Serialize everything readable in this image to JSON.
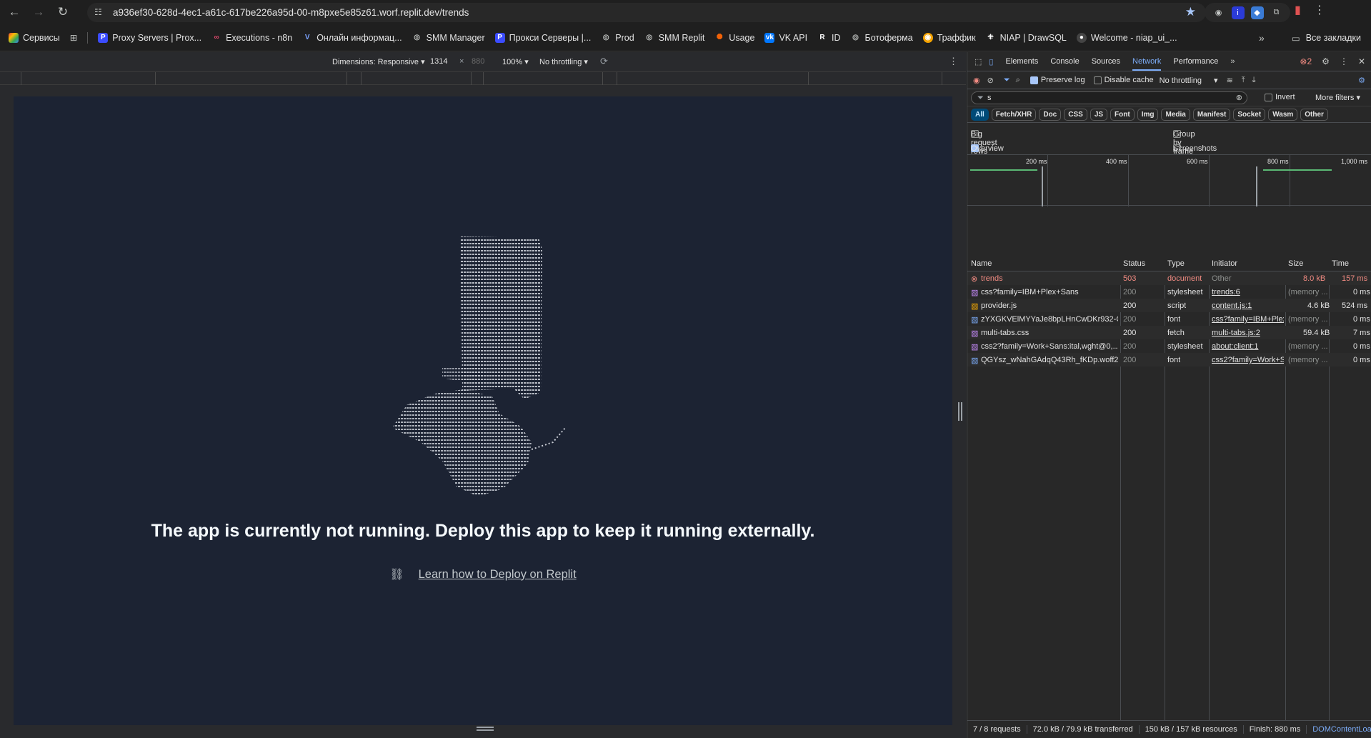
{
  "browser": {
    "url": "a936ef30-628d-4ec1-a61c-617be226a95d-00-m8pxe5e85z61.worf.replit.dev/trends",
    "bookmarks": [
      {
        "label": "Сервисы",
        "icon": "apps-grid-icon",
        "color": "#ea4335"
      },
      {
        "label": "Proxy Servers | Prox...",
        "icon": "proxy-icon",
        "color": "#3b4cff"
      },
      {
        "label": "Executions - n8n",
        "icon": "n8n-icon",
        "color": "#ea4b71"
      },
      {
        "label": "Онлайн информац...",
        "icon": "v-icon",
        "color": "#7aa2ff"
      },
      {
        "label": "SMM Manager",
        "icon": "globe-icon",
        "color": "#9aa0a6"
      },
      {
        "label": "Прокси Серверы |...",
        "icon": "proxy-icon",
        "color": "#3b4cff"
      },
      {
        "label": "Prod",
        "icon": "globe-icon",
        "color": "#9aa0a6"
      },
      {
        "label": "SMM Replit",
        "icon": "globe-icon",
        "color": "#9aa0a6"
      },
      {
        "label": "Usage",
        "icon": "replit-icon",
        "color": "#f26207"
      },
      {
        "label": "VK API",
        "icon": "vk-icon",
        "color": "#0077ff"
      },
      {
        "label": "ID",
        "icon": "r-icon",
        "color": "#ffffff"
      },
      {
        "label": "Ботоферма",
        "icon": "globe-icon",
        "color": "#9aa0a6"
      },
      {
        "label": "Траффик",
        "icon": "traffic-icon",
        "color": "#f4a300"
      },
      {
        "label": "NIAP | DrawSQL",
        "icon": "drawsql-icon",
        "color": "#ffffff"
      },
      {
        "label": "Welcome - niap_ui_...",
        "icon": "github-icon",
        "color": "#ffffff"
      }
    ],
    "all_bookmarks": "Все закладки"
  },
  "device_toolbar": {
    "dimensions": "Dimensions: Responsive",
    "width": "1314",
    "x": "×",
    "height": "880",
    "zoom": "100%",
    "throttling": "No throttling"
  },
  "page": {
    "message": "The app is currently not running. Deploy this app to keep it running externally.",
    "link": "Learn how to Deploy on Replit"
  },
  "devtools": {
    "tabs": [
      "Elements",
      "Console",
      "Sources",
      "Network",
      "Performance"
    ],
    "active_tab": "Network",
    "error_count": "2",
    "preserve_log": "Preserve log",
    "disable_cache": "Disable cache",
    "throttling": "No throttling",
    "filter_value": "s",
    "invert": "Invert",
    "more_filters": "More filters",
    "types": [
      "All",
      "Fetch/XHR",
      "Doc",
      "CSS",
      "JS",
      "Font",
      "Img",
      "Media",
      "Manifest",
      "Socket",
      "Wasm",
      "Other"
    ],
    "options": {
      "big_rows": "Big request rows",
      "group_by_frame": "Group by frame",
      "overview": "Overview",
      "screenshots": "Screenshots"
    },
    "timeline_ticks": [
      "200 ms",
      "400 ms",
      "600 ms",
      "800 ms",
      "1,000 ms"
    ],
    "columns": [
      "Name",
      "Status",
      "Type",
      "Initiator",
      "Size",
      "Time"
    ],
    "rows": [
      {
        "name": "trends",
        "status": "503",
        "type": "document",
        "initiator": "Other",
        "size": "8.0 kB",
        "time": "157 ms"
      },
      {
        "name": "css?family=IBM+Plex+Sans",
        "status": "200",
        "type": "stylesheet",
        "initiator": "trends:6",
        "size": "(memory ...",
        "time": "0 ms"
      },
      {
        "name": "provider.js",
        "status": "200",
        "type": "script",
        "initiator": "content.js:1",
        "size": "4.6 kB",
        "time": "524 ms"
      },
      {
        "name": "zYXGKVElMYYaJe8bpLHnCwDKr932-G...",
        "status": "200",
        "type": "font",
        "initiator": "css?family=IBM+Plex",
        "size": "(memory ...",
        "time": "0 ms"
      },
      {
        "name": "multi-tabs.css",
        "status": "200",
        "type": "fetch",
        "initiator": "multi-tabs.js:2",
        "size": "59.4 kB",
        "time": "7 ms"
      },
      {
        "name": "css2?family=Work+Sans:ital,wght@0,...",
        "status": "200",
        "type": "stylesheet",
        "initiator": "about:client:1",
        "size": "(memory ...",
        "time": "0 ms"
      },
      {
        "name": "QGYsz_wNahGAdqQ43Rh_fKDp.woff2",
        "status": "200",
        "type": "font",
        "initiator": "css2?family=Work+S",
        "size": "(memory ...",
        "time": "0 ms"
      }
    ],
    "status": {
      "requests": "7 / 8 requests",
      "transferred": "72.0 kB / 79.9 kB transferred",
      "resources": "150 kB / 157 kB resources",
      "finish": "Finish: 880 ms",
      "dcl": "DOMContentLoaded:"
    }
  }
}
